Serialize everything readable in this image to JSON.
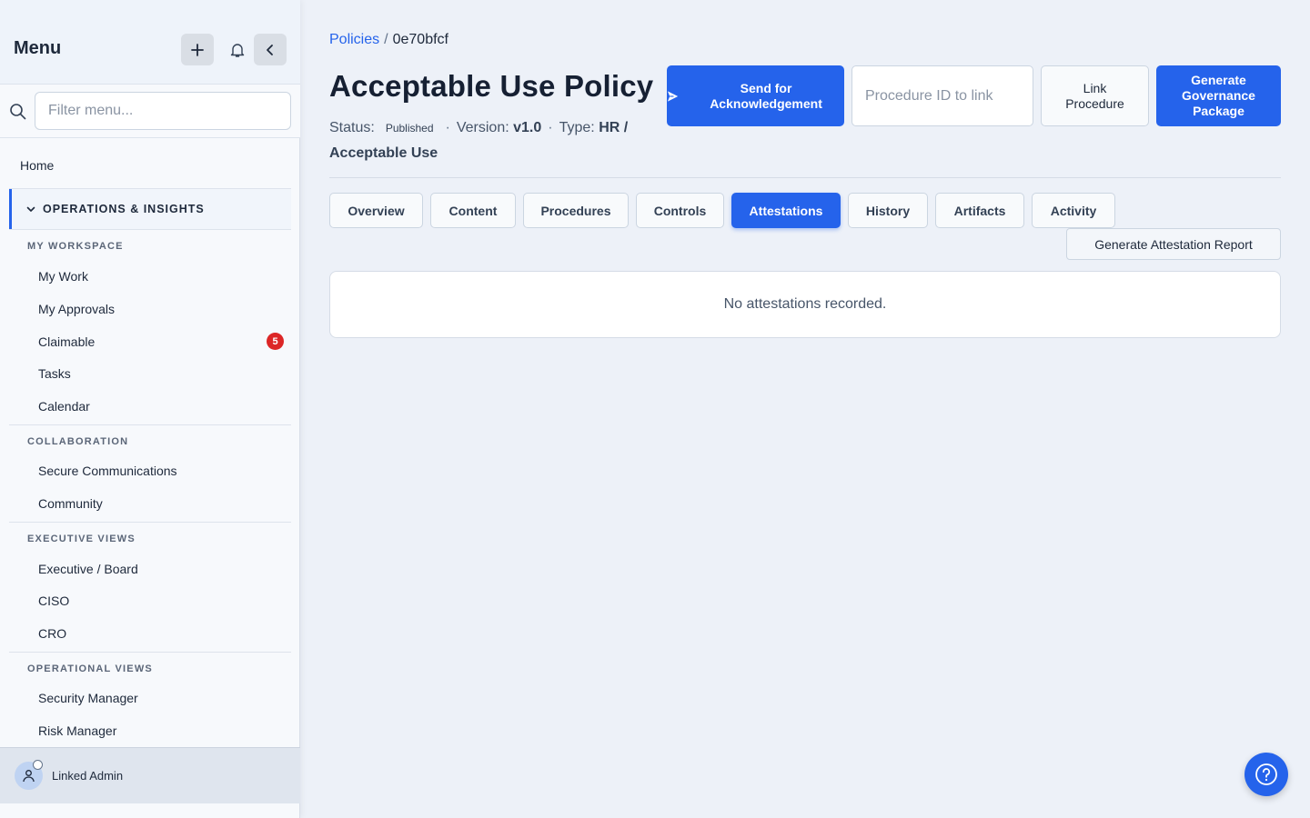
{
  "sidebar": {
    "title": "Menu",
    "filter_placeholder": "Filter menu...",
    "home": "Home",
    "section_label": "OPERATIONS & INSIGHTS",
    "groups": [
      {
        "label": "MY WORKSPACE",
        "items": [
          "My Work",
          "My Approvals",
          "Claimable",
          "Tasks",
          "Calendar"
        ]
      },
      {
        "label": "COLLABORATION",
        "items": [
          "Secure Communications",
          "Community"
        ]
      },
      {
        "label": "EXECUTIVE VIEWS",
        "items": [
          "Executive / Board",
          "CISO",
          "CRO"
        ]
      },
      {
        "label": "OPERATIONAL VIEWS",
        "items": [
          "Security Manager",
          "Risk Manager"
        ]
      }
    ],
    "claimable_badge": "5",
    "user_name": "Linked Admin"
  },
  "breadcrumb": {
    "parent": "Policies",
    "separator": "/",
    "current": "0e70bfcf"
  },
  "policy": {
    "title": "Acceptable Use Policy",
    "status_label": "Status:",
    "status_value": "Published",
    "version_label": "Version:",
    "version_value": "v1.0",
    "type_label": "Type:",
    "type_value": "HR / Acceptable Use"
  },
  "actions": {
    "send_label": "Send for Acknowledgement",
    "procedure_placeholder": "Procedure ID to link",
    "link_label": "Link Procedure",
    "generate_label": "Generate Governance Package"
  },
  "tabs": [
    "Overview",
    "Content",
    "Procedures",
    "Controls",
    "Attestations",
    "History",
    "Artifacts",
    "Activity"
  ],
  "active_tab": "Attestations",
  "report_button": "Generate Attestation Report",
  "empty_message": "No attestations recorded.",
  "colors": {
    "accent": "#2563eb",
    "badge": "#dc2626"
  }
}
